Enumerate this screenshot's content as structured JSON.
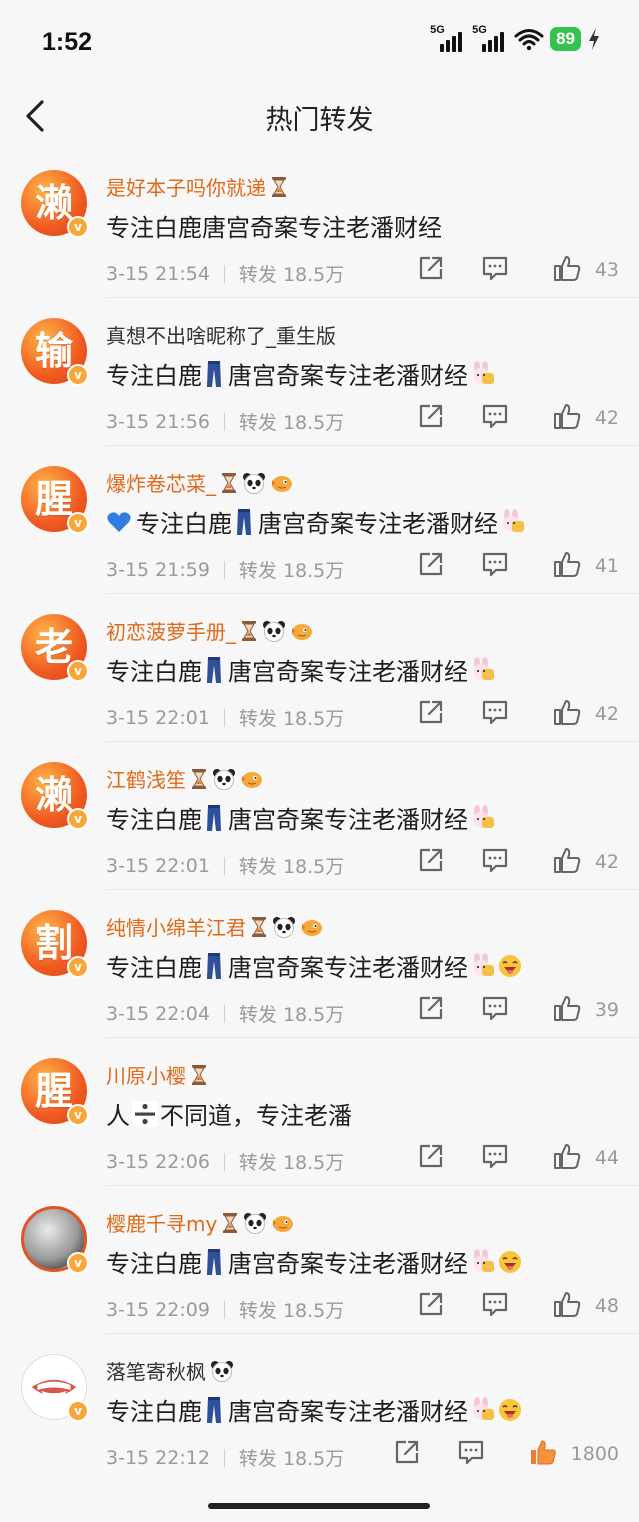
{
  "status": {
    "time": "1:52",
    "sim1": "5G",
    "sim2": "5G",
    "battery": "89"
  },
  "header": {
    "title": "热门转发"
  },
  "items": [
    {
      "avatar_char": "濑",
      "name": "是好本子吗你就递",
      "name_suffix": [
        "hourglass"
      ],
      "name_color": "#e06a1a",
      "text": "专注白鹿唐宫奇案专注老潘财经",
      "layout": "plain",
      "time": "3-15 21:54",
      "repost": "转发 18.5万",
      "likes": "43"
    },
    {
      "avatar_char": "输",
      "name": "真想不出啥昵称了_重生版",
      "name_suffix": [],
      "name_color": "#333333",
      "text1": "专注白鹿",
      "text2": "唐宫奇案专注老潘财经",
      "layout": "jeans",
      "stickers": 1,
      "time": "3-15 21:56",
      "repost": "转发 18.5万",
      "likes": "42"
    },
    {
      "avatar_char": "腥",
      "name": "爆炸卷芯菜_",
      "name_suffix": [
        "hourglass",
        "panda",
        "fish"
      ],
      "name_color": "#e06a1a",
      "text1": "专注白鹿",
      "text2": "唐宫奇案专注老潘财经",
      "layout": "heart-jeans",
      "stickers": 1,
      "time": "3-15 21:59",
      "repost": "转发 18.5万",
      "likes": "41"
    },
    {
      "avatar_char": "老",
      "name": "初恋菠萝手册_",
      "name_suffix": [
        "hourglass",
        "panda",
        "fish"
      ],
      "name_color": "#e06a1a",
      "text1": "专注白鹿",
      "text2": "唐宫奇案专注老潘财经",
      "layout": "jeans",
      "stickers": 1,
      "time": "3-15 22:01",
      "repost": "转发 18.5万",
      "likes": "42"
    },
    {
      "avatar_char": "濑",
      "name": "江鹤浅笙",
      "name_suffix": [
        "hourglass",
        "panda",
        "fish"
      ],
      "name_color": "#e06a1a",
      "text1": "专注白鹿",
      "text2": "唐宫奇案专注老潘财经",
      "layout": "jeans",
      "stickers": 1,
      "time": "3-15 22:01",
      "repost": "转发 18.5万",
      "likes": "42"
    },
    {
      "avatar_char": "割",
      "name": "纯情小绵羊江君",
      "name_suffix": [
        "hourglass",
        "panda",
        "fish"
      ],
      "name_color": "#e06a1a",
      "text1": "专注白鹿",
      "text2": "唐宫奇案专注老潘财经",
      "layout": "jeans",
      "stickers": 2,
      "time": "3-15 22:04",
      "repost": "转发 18.5万",
      "likes": "39"
    },
    {
      "avatar_char": "腥",
      "name": "川原小樱",
      "name_suffix": [
        "hourglass"
      ],
      "name_color": "#e06a1a",
      "text1": "人",
      "text2": "不同道，专注老潘",
      "layout": "divide",
      "time": "3-15 22:06",
      "repost": "转发 18.5万",
      "likes": "44"
    },
    {
      "avatar_char": "",
      "avatar_style": "coin",
      "name": "樱鹿千寻my",
      "name_suffix": [
        "hourglass",
        "panda",
        "fish"
      ],
      "name_color": "#e06a1a",
      "text1": "专注白鹿",
      "text2": "唐宫奇案专注老潘财经",
      "layout": "jeans",
      "stickers": 2,
      "time": "3-15 22:09",
      "repost": "转发 18.5万",
      "likes": "48"
    },
    {
      "avatar_char": "",
      "avatar_style": "mouth",
      "name": "落笔寄秋枫",
      "name_suffix": [
        "panda"
      ],
      "name_color": "#333333",
      "text1": "专注白鹿",
      "text2": "唐宫奇案专注老潘财经",
      "layout": "jeans",
      "stickers": 2,
      "time": "3-15 22:12",
      "repost": "转发 18.5万",
      "likes": "1800",
      "liked": true
    }
  ]
}
